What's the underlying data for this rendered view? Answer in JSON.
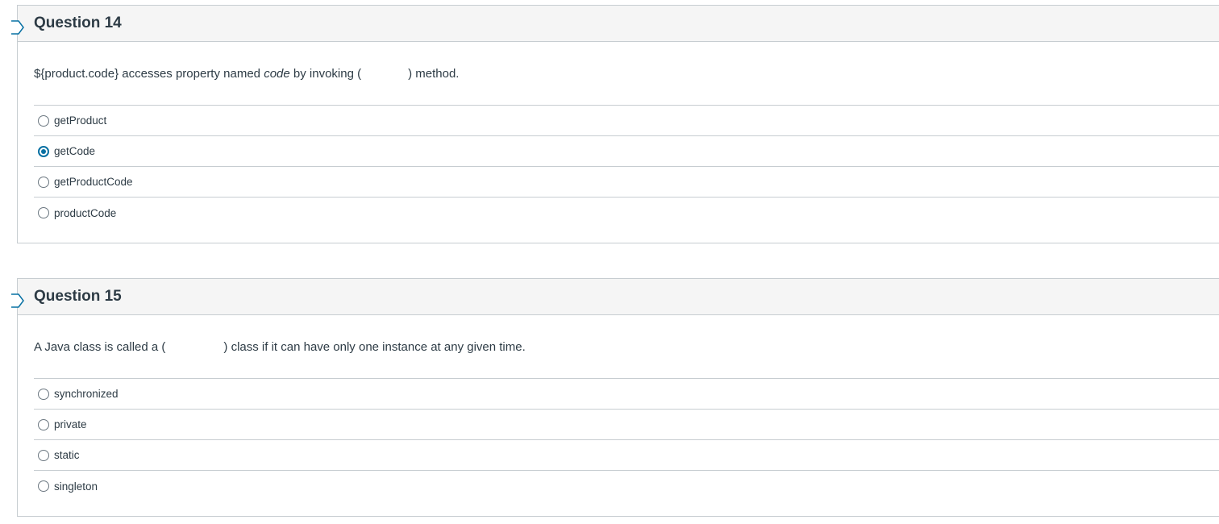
{
  "questions": [
    {
      "title": "Question 14",
      "text_before": "${product.code} accesses property named ",
      "text_italic": "code",
      "text_mid": " by invoking (",
      "text_after": ") method.",
      "answers": [
        {
          "label": "getProduct",
          "selected": false
        },
        {
          "label": "getCode",
          "selected": true
        },
        {
          "label": "getProductCode",
          "selected": false
        },
        {
          "label": "productCode",
          "selected": false
        }
      ]
    },
    {
      "title": "Question 15",
      "text_before": "A Java class is called a (",
      "text_after": ") class if it can have only one instance at any given time.",
      "answers": [
        {
          "label": "synchronized",
          "selected": false
        },
        {
          "label": "private",
          "selected": false
        },
        {
          "label": "static",
          "selected": false
        },
        {
          "label": "singleton",
          "selected": false
        }
      ]
    }
  ],
  "colors": {
    "accent": "#0770a3",
    "header_bg": "#f5f5f5",
    "border": "#c7cdd1",
    "text": "#2d3b45"
  },
  "icons": {
    "flag": "flag-question-icon",
    "radio": "radio-button-icon"
  }
}
